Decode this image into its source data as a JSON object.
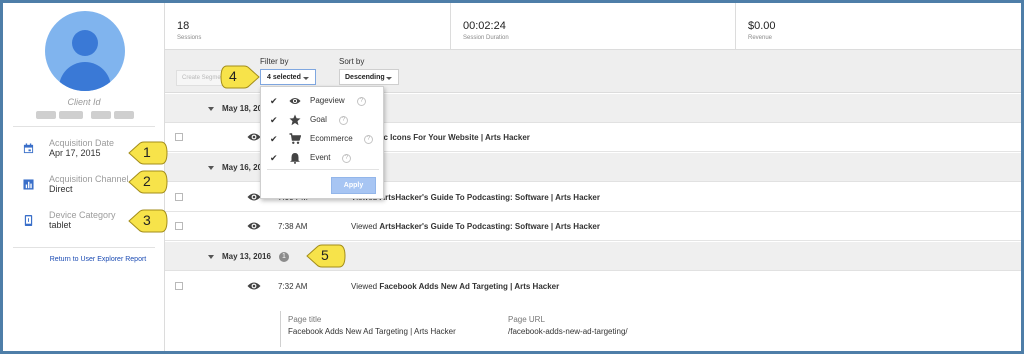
{
  "sidebar": {
    "client_label": "Client Id",
    "meta": [
      {
        "label": "Acquisition Date",
        "value": "Apr 17, 2015",
        "icon": "calendar-icon"
      },
      {
        "label": "Acquisition Channel",
        "value": "Direct",
        "icon": "bar-chart-icon"
      },
      {
        "label": "Device Category",
        "value": "tablet",
        "icon": "device-icon"
      }
    ],
    "return_link": "Return to User Explorer Report"
  },
  "stats": [
    {
      "value": "18",
      "caption": "Sessions"
    },
    {
      "value": "00:02:24",
      "caption": "Session Duration"
    },
    {
      "value": "$0.00",
      "caption": "Revenue"
    }
  ],
  "toolbar": {
    "create_segment": "Create Segment",
    "filter_label": "Filter by",
    "filter_value": "4 selected",
    "sort_label": "Sort by",
    "sort_value": "Descending"
  },
  "filter_menu": {
    "options": [
      {
        "label": "Pageview",
        "checked": true,
        "icon": "eye-icon"
      },
      {
        "label": "Goal",
        "checked": true,
        "icon": "star-icon"
      },
      {
        "label": "Ecommerce",
        "checked": true,
        "icon": "cart-icon"
      },
      {
        "label": "Event",
        "checked": true,
        "icon": "bell-icon"
      }
    ],
    "apply_label": "Apply",
    "help": "?"
  },
  "activity": {
    "groups": [
      {
        "date": "May 18, 20",
        "rows": [
          {
            "time": "",
            "prefix": "",
            "title": "ree Music Icons For Your Website | Arts Hacker"
          }
        ]
      },
      {
        "date": "May 16, 20",
        "rows": [
          {
            "time": "7:00 PM",
            "prefix": "Viewed",
            "title": "ArtsHacker's Guide To Podcasting: Software | Arts Hacker"
          },
          {
            "time": "7:38 AM",
            "prefix": "Viewed",
            "title": "ArtsHacker's Guide To Podcasting: Software | Arts Hacker"
          }
        ]
      },
      {
        "date": "May 13, 2016",
        "count": "1",
        "rows": [
          {
            "time": "7:32 AM",
            "prefix": "Viewed",
            "title": "Facebook Adds New Ad Targeting | Arts Hacker"
          }
        ]
      }
    ],
    "detail": {
      "page_title_label": "Page title",
      "page_title_value": "Facebook Adds New Ad Targeting | Arts Hacker",
      "page_url_label": "Page URL",
      "page_url_value": "/facebook-adds-new-ad-targeting/"
    }
  },
  "callouts": [
    "1",
    "2",
    "3",
    "4",
    "5"
  ],
  "colors": {
    "accent": "#4e7ea8",
    "avatar_bg": "#80b4ee",
    "avatar_fg": "#3a79d6",
    "icon_blue": "#3a6fc9",
    "callout": "#f7e34a"
  }
}
